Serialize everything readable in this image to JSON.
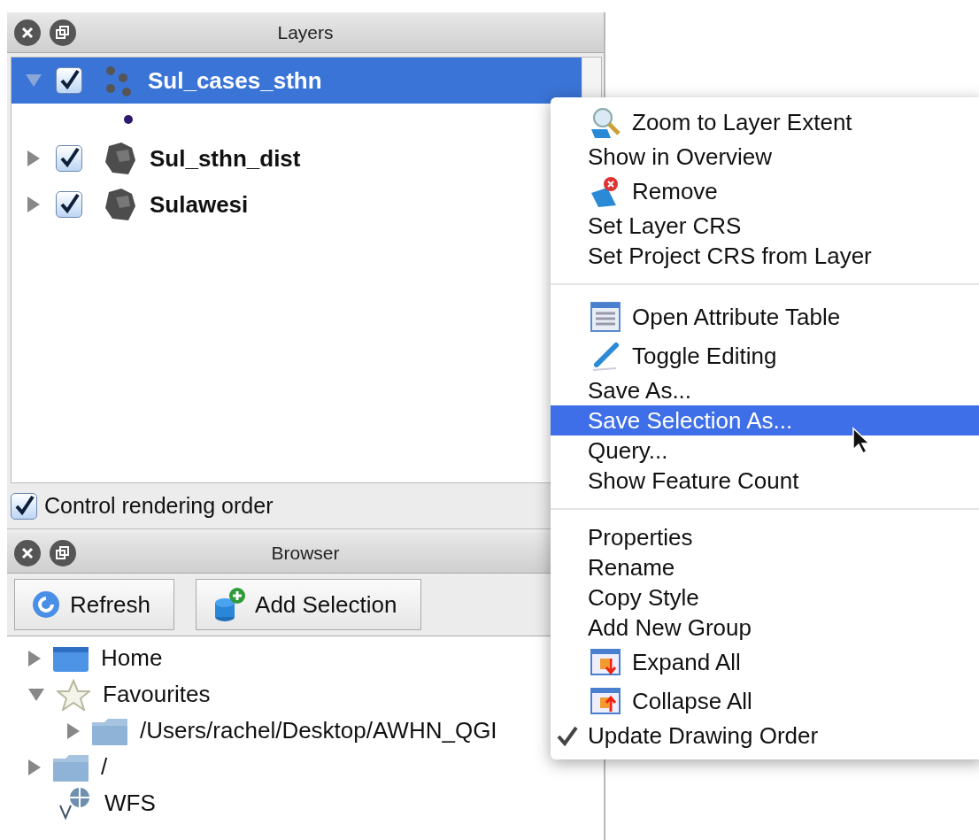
{
  "layers_panel": {
    "title": "Layers",
    "layers": [
      {
        "name": "Sul_cases_sthn",
        "kind": "points",
        "expanded": true,
        "checked": true,
        "selected": true,
        "children": [
          {
            "kind": "symbol"
          }
        ]
      },
      {
        "name": "Sul_sthn_dist",
        "kind": "polygon",
        "expanded": false,
        "checked": true,
        "selected": false
      },
      {
        "name": "Sulawesi",
        "kind": "polygon",
        "expanded": false,
        "checked": true,
        "selected": false
      }
    ],
    "option": {
      "label": "Control rendering order",
      "checked": true
    }
  },
  "browser_panel": {
    "title": "Browser",
    "buttons": [
      {
        "label": "Refresh",
        "kind": "refresh"
      },
      {
        "label": "Add Selection",
        "kind": "add"
      }
    ],
    "tree": [
      {
        "label": "Home",
        "kind": "home",
        "expanded": false
      },
      {
        "label": "Favourites",
        "kind": "star",
        "expanded": true,
        "children": [
          {
            "label": "/Users/rachel/Desktop/AWHN_QGI",
            "kind": "folder",
            "expanded": false
          }
        ]
      },
      {
        "label": "/",
        "kind": "folder",
        "expanded": false
      },
      {
        "label": "WFS",
        "kind": "wfs"
      }
    ]
  },
  "context_menu": {
    "sections": [
      [
        {
          "label": "Zoom to Layer Extent",
          "kind": "zoom",
          "selected": false,
          "checked": false
        },
        {
          "label": "Show in Overview",
          "kind": "plain",
          "selected": false,
          "checked": false
        },
        {
          "label": "Remove",
          "kind": "remove",
          "selected": false,
          "checked": false
        },
        {
          "label": "Set Layer CRS",
          "kind": "plain",
          "selected": false,
          "checked": false
        },
        {
          "label": "Set Project CRS from Layer",
          "kind": "plain",
          "selected": false,
          "checked": false
        }
      ],
      [
        {
          "label": "Open Attribute Table",
          "kind": "table",
          "selected": false,
          "checked": false
        },
        {
          "label": "Toggle Editing",
          "kind": "pencil",
          "selected": false,
          "checked": false
        },
        {
          "label": "Save As...",
          "kind": "plain",
          "selected": false,
          "checked": false
        },
        {
          "label": "Save Selection As...",
          "kind": "plain",
          "selected": true,
          "checked": false
        },
        {
          "label": "Query...",
          "kind": "plain",
          "selected": false,
          "checked": false
        },
        {
          "label": "Show Feature Count",
          "kind": "plain",
          "selected": false,
          "checked": false
        }
      ],
      [
        {
          "label": "Properties",
          "kind": "plain",
          "selected": false,
          "checked": false
        },
        {
          "label": "Rename",
          "kind": "plain",
          "selected": false,
          "checked": false
        },
        {
          "label": "Copy Style",
          "kind": "plain",
          "selected": false,
          "checked": false
        },
        {
          "label": "Add New Group",
          "kind": "plain",
          "selected": false,
          "checked": false
        },
        {
          "label": "Expand All",
          "kind": "expand",
          "selected": false,
          "checked": false
        },
        {
          "label": "Collapse All",
          "kind": "collapse",
          "selected": false,
          "checked": false
        },
        {
          "label": "Update Drawing Order",
          "kind": "plain",
          "selected": false,
          "checked": true
        }
      ]
    ]
  }
}
